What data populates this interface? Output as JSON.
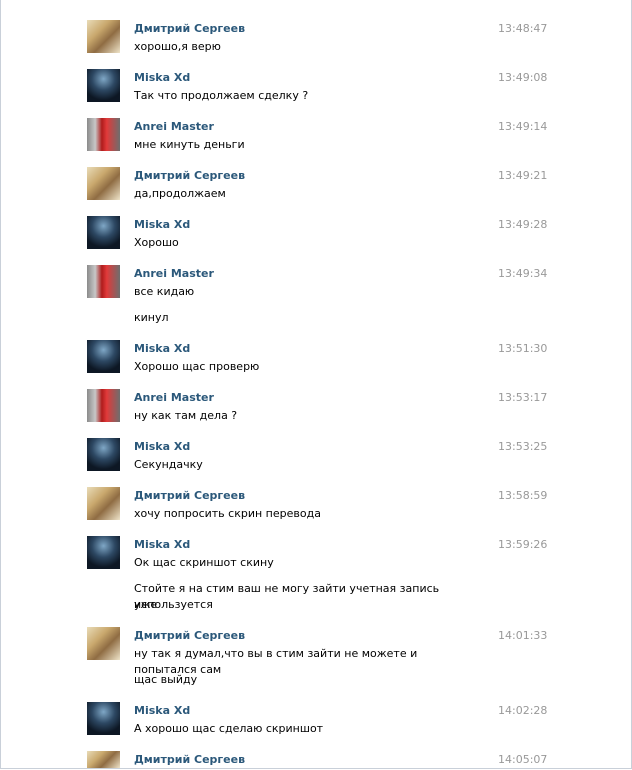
{
  "top_clipped_text": "...",
  "messages": [
    {
      "author": "Дмитрий Сергеев",
      "time": "13:48:47",
      "lines": [
        "хорошо,я верю"
      ]
    },
    {
      "author": "Miska Xd",
      "time": "13:49:08",
      "lines": [
        "Так что продолжаем сделку ?"
      ]
    },
    {
      "author": "Anrei Master",
      "time": "13:49:14",
      "lines": [
        "мне кинуть деньги"
      ]
    },
    {
      "author": "Дмитрий Сергеев",
      "time": "13:49:21",
      "lines": [
        "да,продолжаем"
      ]
    },
    {
      "author": "Miska Xd",
      "time": "13:49:28",
      "lines": [
        "Хорошо"
      ]
    },
    {
      "author": "Anrei Master",
      "time": "13:49:34",
      "lines": [
        "все кидаю",
        "кинул"
      ]
    },
    {
      "author": "Miska Xd",
      "time": "13:51:30",
      "lines": [
        "Хорошо щас проверю"
      ]
    },
    {
      "author": "Anrei Master",
      "time": "13:53:17",
      "lines": [
        "ну как там дела ?"
      ]
    },
    {
      "author": "Miska Xd",
      "time": "13:53:25",
      "lines": [
        "Секундачку"
      ]
    },
    {
      "author": "Дмитрий Сергеев",
      "time": "13:58:59",
      "lines": [
        "хочу попросить скрин перевода"
      ]
    },
    {
      "author": "Miska Xd",
      "time": "13:59:26",
      "lines": [
        "Ок щас скриншот скину",
        "Стойте я на стим ваш не могу зайти учетная запись уже",
        "используется"
      ]
    },
    {
      "author": "Дмитрий Сергеев",
      "time": "14:01:33",
      "lines": [
        "ну так я думал,что вы в стим зайти не можете и попытался сам",
        "щас выйду"
      ]
    },
    {
      "author": "Miska Xd",
      "time": "14:02:28",
      "lines": [
        "А хорошо щас сделаю скриншот"
      ]
    },
    {
      "author": "Дмитрий Сергеев",
      "time": "14:05:07",
      "lines": []
    }
  ]
}
